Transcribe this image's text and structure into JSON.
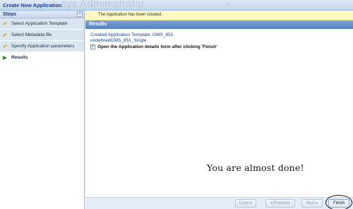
{
  "window": {
    "title": "Create New Application",
    "background_title": "sys Administrator",
    "background_links": [
      "Rn... ...",
      "...",
      "... ..."
    ]
  },
  "steps": {
    "header": "Steps",
    "collapse_icon": "double-chevron-left",
    "items": [
      {
        "label": "Select Application Template",
        "state": "done"
      },
      {
        "label": "Select Metadata file",
        "state": "done"
      },
      {
        "label": "Specify Application parameters",
        "state": "done"
      },
      {
        "label": "Results",
        "state": "current"
      }
    ]
  },
  "notice": {
    "text": "The Application has been created."
  },
  "results": {
    "header": "Results",
    "line1": "Created Application Template: GMS_851",
    "line2": "undefinedGMS_851_Single",
    "checkbox_label": "Open the Application details form after clicking 'Finish'",
    "checkbox_checked": true,
    "annotation": "You are almost done!"
  },
  "footer": {
    "cancel": "Cancel",
    "previous": "◂ Previous",
    "next": "Next ▸",
    "finish": "Finish"
  },
  "colors": {
    "accent": "#15428b",
    "header_blue": "#5682c2",
    "notice_bg": "#fcf8c4"
  }
}
